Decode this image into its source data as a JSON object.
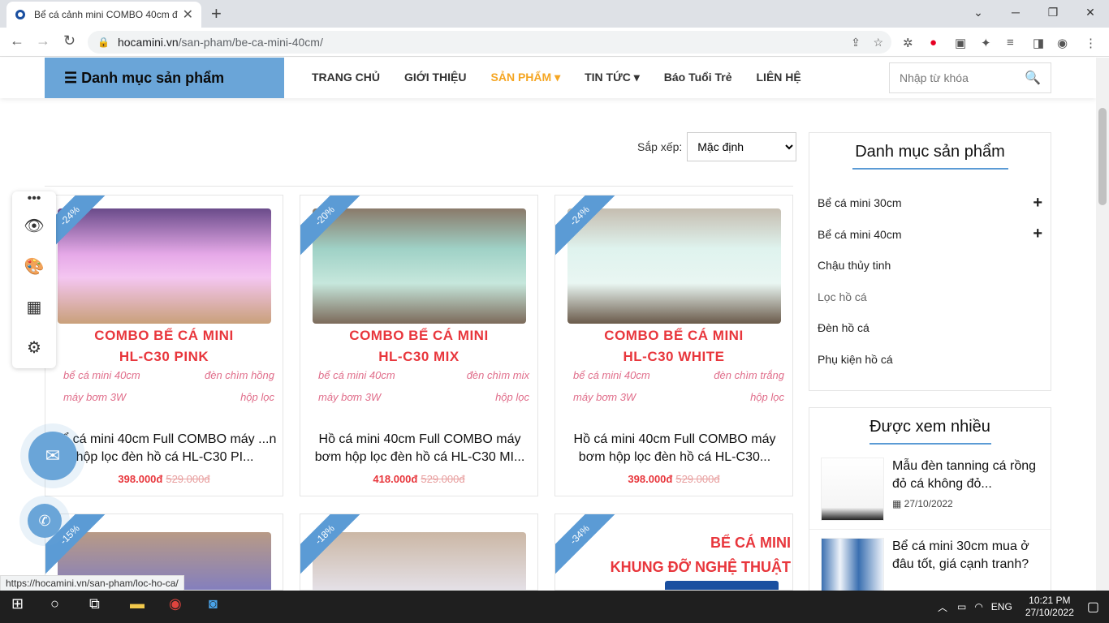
{
  "browser": {
    "tab_title": "Bể cá cảnh mini COMBO 40cm đ",
    "url_host": "hocamini.vn",
    "url_path": "/san-pham/be-ca-mini-40cm/",
    "status_url": "https://hocamini.vn/san-pham/loc-ho-ca/"
  },
  "header": {
    "category_menu": "☰ Danh mục sản phẩm",
    "nav": [
      {
        "label": "TRANG CHỦ"
      },
      {
        "label": "GIỚI THIỆU"
      },
      {
        "label": "SẢN PHẨM ▾"
      },
      {
        "label": "TIN TỨC ▾"
      },
      {
        "label": "Báo Tuổi Trẻ"
      },
      {
        "label": "LIÊN HỆ"
      }
    ],
    "search_placeholder": "Nhập từ khóa"
  },
  "sort": {
    "label": "Sắp xếp:",
    "value": "Mặc định"
  },
  "products": [
    {
      "badge": "-24%",
      "combo1": "COMBO BỂ CÁ MINI",
      "combo2": "HL-C30 PINK",
      "tags": [
        "bể cá mini 40cm",
        "đèn chìm hồng",
        "máy bơm 3W",
        "hộp lọc"
      ],
      "name": "Bể cá mini 40cm Full COMBO máy ...n hộp lọc đèn hồ cá HL-C30 PI...",
      "price": "398.000đ",
      "old_price": "529.000đ"
    },
    {
      "badge": "-20%",
      "combo1": "COMBO BỂ CÁ MINI",
      "combo2": "HL-C30 MIX",
      "tags": [
        "bể cá mini 40cm",
        "đèn chìm mix",
        "máy bơm 3W",
        "hộp lọc"
      ],
      "name": "Hồ cá mini 40cm Full COMBO máy bơm hộp lọc đèn hồ cá HL-C30 MI...",
      "price": "418.000đ",
      "old_price": "529.000đ"
    },
    {
      "badge": "-24%",
      "combo1": "COMBO BỂ CÁ MINI",
      "combo2": "HL-C30 WHITE",
      "tags": [
        "bể cá mini 40cm",
        "đèn chìm trắng",
        "máy bơm 3W",
        "hộp lọc"
      ],
      "name": "Hồ cá mini 40cm Full COMBO máy bơm hộp lọc đèn hồ cá HL-C30...",
      "price": "398.000đ",
      "old_price": "529.000đ"
    }
  ],
  "products_row2": [
    {
      "badge": "-15%"
    },
    {
      "badge": "-18%"
    },
    {
      "badge": "-34%",
      "banner1": "BỂ CÁ MINI",
      "banner2": "KHUNG ĐỠ NGHỆ THUẬT"
    }
  ],
  "sidebar": {
    "categories_title": "Danh mục sản phẩm",
    "categories": [
      {
        "label": "Bể cá mini 30cm",
        "expand": "+"
      },
      {
        "label": "Bể cá mini 40cm",
        "expand": "+"
      },
      {
        "label": "Chậu thủy tinh",
        "expand": ""
      },
      {
        "label": "Lọc hồ cá",
        "expand": ""
      },
      {
        "label": "Đèn hồ cá",
        "expand": ""
      },
      {
        "label": "Phụ kiện hồ cá",
        "expand": ""
      }
    ],
    "popular_title": "Được xem nhiều",
    "posts": [
      {
        "title": "Mẫu đèn tanning cá rồng đỏ cá không đỏ...",
        "date": "27/10/2022"
      },
      {
        "title": "Bể cá mini 30cm mua ở đâu tốt, giá cạnh tranh?",
        "date": ""
      }
    ]
  },
  "taskbar": {
    "lang": "ENG",
    "time": "10:21 PM",
    "date": "27/10/2022"
  },
  "colors": {
    "accent": "#6aa5d8",
    "sale_red": "#e8363c",
    "nav_active": "#f5a623"
  }
}
